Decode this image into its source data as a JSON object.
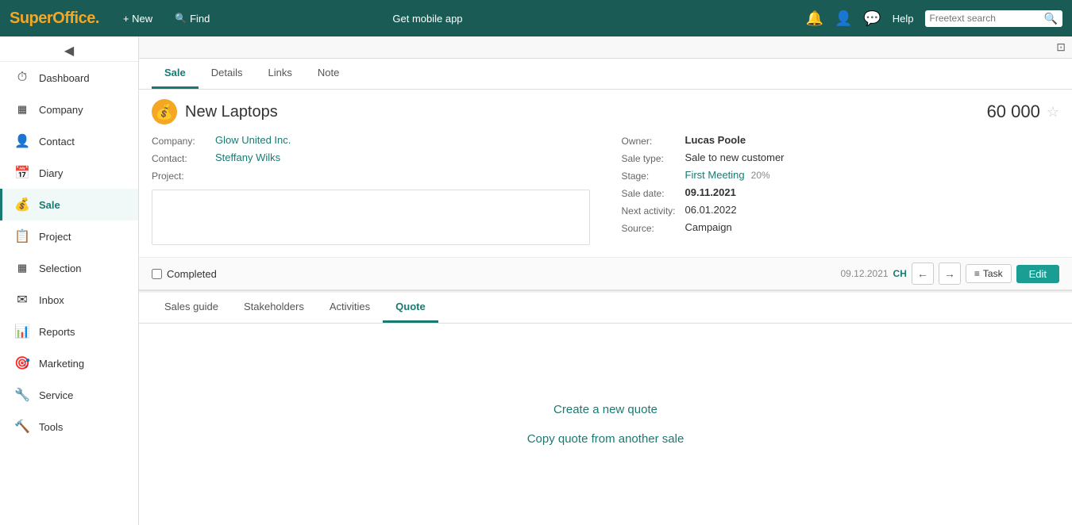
{
  "app": {
    "logo_text": "SuperOffice",
    "logo_dot": "."
  },
  "topnav": {
    "new_label": "+ New",
    "find_label": "Find",
    "mobile_app_label": "Get mobile app",
    "help_label": "Help",
    "search_placeholder": "Freetext search"
  },
  "sidebar": {
    "collapse_icon": "◀",
    "items": [
      {
        "id": "dashboard",
        "label": "Dashboard",
        "icon": "⏱",
        "active": false
      },
      {
        "id": "company",
        "label": "Company",
        "icon": "▦",
        "active": false
      },
      {
        "id": "contact",
        "label": "Contact",
        "icon": "👤",
        "active": false
      },
      {
        "id": "diary",
        "label": "Diary",
        "icon": "📅",
        "active": false
      },
      {
        "id": "sale",
        "label": "Sale",
        "icon": "💰",
        "active": true
      },
      {
        "id": "project",
        "label": "Project",
        "icon": "📋",
        "active": false
      },
      {
        "id": "selection",
        "label": "Selection",
        "icon": "▦",
        "active": false
      },
      {
        "id": "inbox",
        "label": "Inbox",
        "icon": "✉",
        "active": false
      },
      {
        "id": "reports",
        "label": "Reports",
        "icon": "📊",
        "active": false
      },
      {
        "id": "marketing",
        "label": "Marketing",
        "icon": "🎯",
        "active": false
      },
      {
        "id": "service",
        "label": "Service",
        "icon": "🔧",
        "active": false
      },
      {
        "id": "tools",
        "label": "Tools",
        "icon": "🔨",
        "active": false
      }
    ]
  },
  "upper_panel": {
    "tabs": [
      {
        "id": "sale",
        "label": "Sale",
        "active": true
      },
      {
        "id": "details",
        "label": "Details",
        "active": false
      },
      {
        "id": "links",
        "label": "Links",
        "active": false
      },
      {
        "id": "note",
        "label": "Note",
        "active": false
      }
    ],
    "sale": {
      "title": "New Laptops",
      "amount": "60 000",
      "star_icon": "☆",
      "company_label": "Company:",
      "company_value": "Glow United Inc.",
      "contact_label": "Contact:",
      "contact_value": "Steffany Wilks",
      "project_label": "Project:",
      "project_value": "",
      "owner_label": "Owner:",
      "owner_value": "Lucas Poole",
      "sale_type_label": "Sale type:",
      "sale_type_value": "Sale to new customer",
      "stage_label": "Stage:",
      "stage_value": "First Meeting",
      "stage_pct": "20%",
      "sale_date_label": "Sale date:",
      "sale_date_value": "09.11.2021",
      "next_activity_label": "Next activity:",
      "next_activity_value": "06.01.2022",
      "source_label": "Source:",
      "source_value": "Campaign",
      "description_placeholder": ""
    },
    "bottom_bar": {
      "completed_label": "Completed",
      "date": "09.12.2021",
      "badge": "CH",
      "prev_icon": "←",
      "next_icon": "→",
      "task_icon": "≡",
      "task_label": "Task",
      "edit_label": "Edit"
    }
  },
  "lower_panel": {
    "tabs": [
      {
        "id": "sales-guide",
        "label": "Sales guide",
        "active": false
      },
      {
        "id": "stakeholders",
        "label": "Stakeholders",
        "active": false
      },
      {
        "id": "activities",
        "label": "Activities",
        "active": false
      },
      {
        "id": "quote",
        "label": "Quote",
        "active": true
      }
    ],
    "quote": {
      "create_label": "Create a new quote",
      "copy_label": "Copy quote from another sale"
    }
  }
}
